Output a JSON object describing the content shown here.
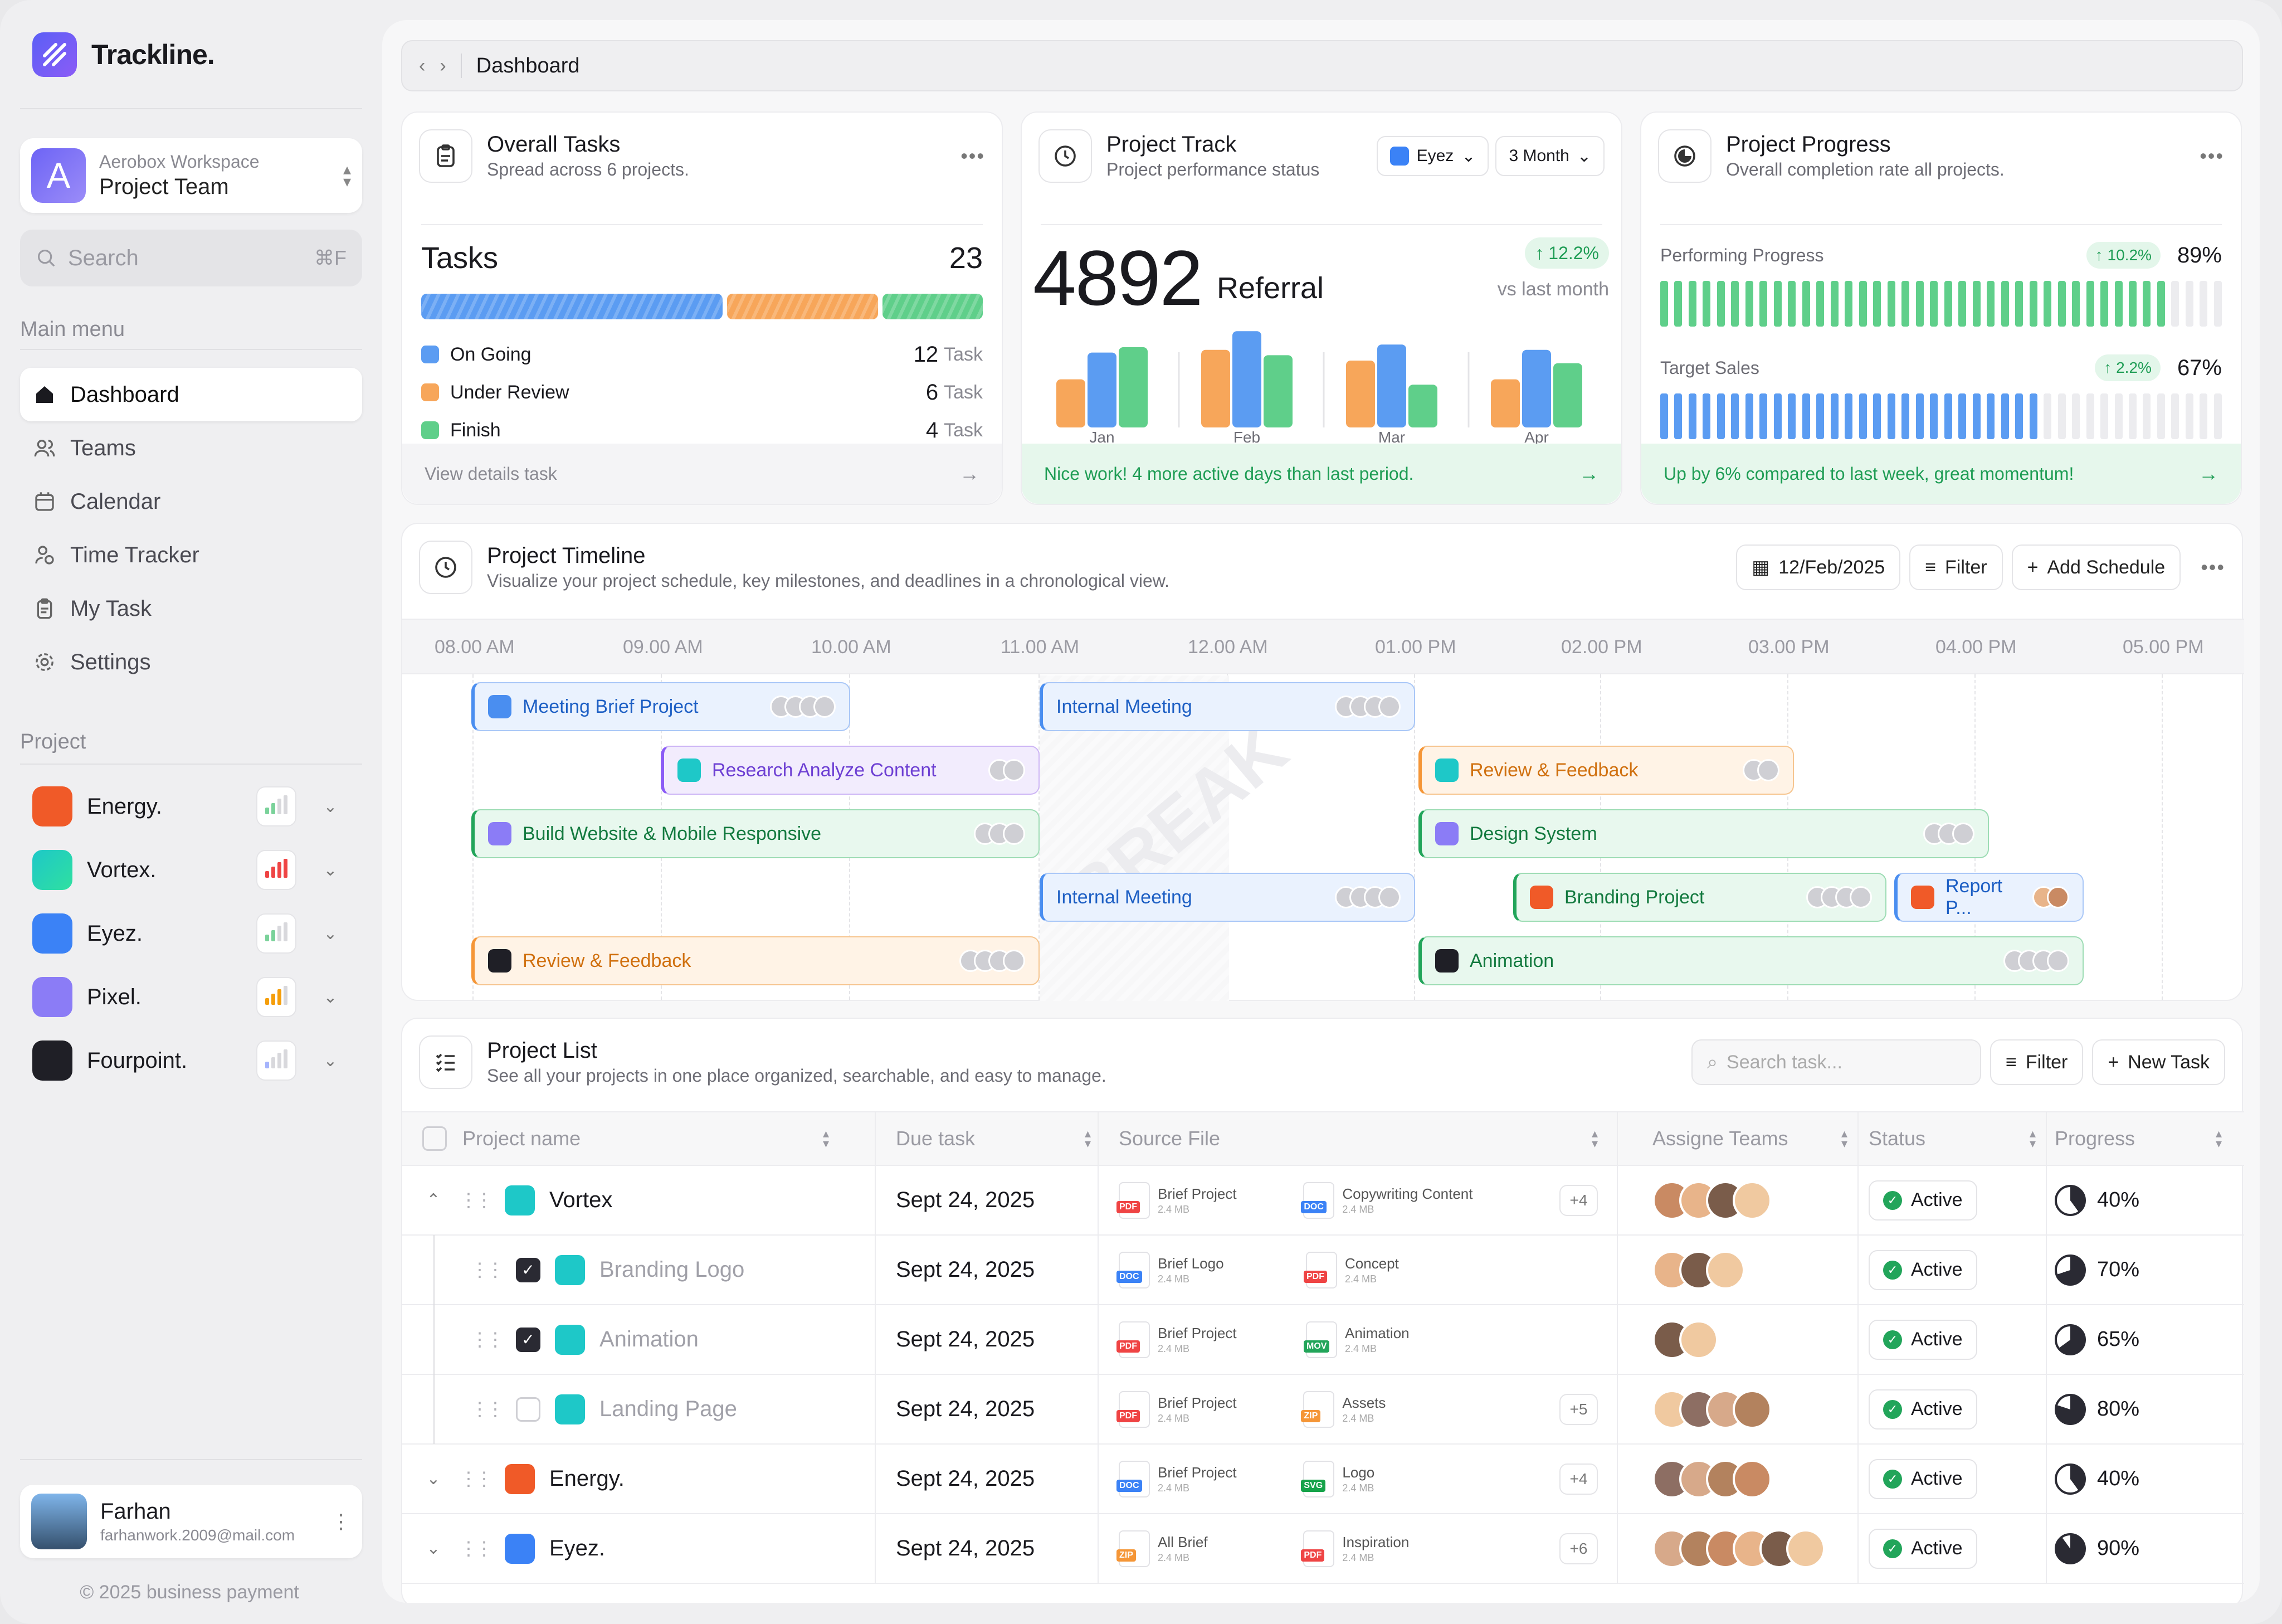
{
  "app": {
    "name": "Trackline.",
    "copyright": "© 2025 business payment"
  },
  "workspace": {
    "avatar": "A",
    "org": "Aerobox Workspace",
    "team": "Project Team"
  },
  "search": {
    "placeholder": "Search",
    "shortcut": "⌘F"
  },
  "sidebar": {
    "main_menu_label": "Main menu",
    "project_label": "Project",
    "menu": [
      {
        "label": "Dashboard",
        "icon": "home-icon",
        "active": true
      },
      {
        "label": "Teams",
        "icon": "users-icon"
      },
      {
        "label": "Calendar",
        "icon": "calendar-icon"
      },
      {
        "label": "Time Tracker",
        "icon": "person-clock-icon"
      },
      {
        "label": "My Task",
        "icon": "clipboard-icon"
      },
      {
        "label": "Settings",
        "icon": "gear-icon"
      }
    ],
    "projects": [
      {
        "name": "Energy.",
        "color": "#f05a28",
        "bar_color": "#7ad29a"
      },
      {
        "name": "Vortex.",
        "color": "#1ec8c8",
        "bar_color": "#ef4444"
      },
      {
        "name": "Eyez.",
        "color": "#3b82f6",
        "bar_color": "#7ad29a"
      },
      {
        "name": "Pixel.",
        "color": "#8b7cf6",
        "bar_color": "#f59e0b"
      },
      {
        "name": "Fourpoint.",
        "color": "#1f1f26",
        "bar_color": "#a5b4fc"
      }
    ]
  },
  "user": {
    "name": "Farhan",
    "email": "farhanwork.2009@mail.com"
  },
  "breadcrumb": {
    "page": "Dashboard"
  },
  "overall_tasks": {
    "title": "Overall Tasks",
    "subtitle": "Spread across 6 projects.",
    "tasks_label": "Tasks",
    "total": "23",
    "unit": "Task",
    "rows": [
      {
        "label": "On Going",
        "count": "12",
        "color": "#5b9cf2"
      },
      {
        "label": "Under Review",
        "count": "6",
        "color": "#f7a65a"
      },
      {
        "label": "Finish",
        "count": "4",
        "color": "#5fcf8a"
      }
    ],
    "footer": "View details task"
  },
  "project_track": {
    "title": "Project Track",
    "subtitle": "Project performance status",
    "project_filter": "Eyez",
    "period": "3 Month",
    "value": "4892",
    "value_label": "Referral",
    "delta": "12.2%",
    "delta_note": "vs last month",
    "chart_data": {
      "type": "bar",
      "categories": [
        "Jan",
        "Feb",
        "Mar",
        "Apr"
      ],
      "series": [
        {
          "values": [
            36,
            58,
            50,
            36
          ],
          "color": "#f7a65a"
        },
        {
          "values": [
            56,
            72,
            62,
            58
          ],
          "color": "#5b9cf2"
        },
        {
          "values": [
            60,
            54,
            32,
            48
          ],
          "color": "#5fcf8a"
        }
      ]
    },
    "footer": "Nice work! 4 more active days than last period."
  },
  "project_progress": {
    "title": "Project Progress",
    "subtitle": "Overall completion rate all projects.",
    "metrics": [
      {
        "label": "Performing Progress",
        "delta": "10.2%",
        "value": "89%",
        "fraction": 0.89,
        "color": "#5fcf8a"
      },
      {
        "label": "Target Sales",
        "delta": "2.2%",
        "value": "67%",
        "fraction": 0.67,
        "color": "#5b9cf2"
      }
    ],
    "footer": "Up by 6% compared to last week, great momentum!"
  },
  "timeline": {
    "title": "Project Timeline",
    "subtitle": "Visualize your project schedule, key milestones, and deadlines in a chronological view.",
    "date": "12/Feb/2025",
    "filter": "Filter",
    "add": "Add Schedule",
    "watermark": "BREAK",
    "hours": [
      "08.00 AM",
      "09.00 AM",
      "10.00 AM",
      "11.00 AM",
      "12.00 AM",
      "01.00 PM",
      "02.00 PM",
      "03.00 PM",
      "04.00 PM",
      "05.00 PM"
    ],
    "tasks": [
      {
        "label": "Meeting Brief Project",
        "style": "blue",
        "icon": "#4a8ef0"
      },
      {
        "label": "Internal Meeting",
        "style": "blue",
        "icon": ""
      },
      {
        "label": "Research Analyze Content",
        "style": "purple",
        "icon": "#1ec8c8"
      },
      {
        "label": "Review & Feedback",
        "style": "orange",
        "icon": "#1ec8c8"
      },
      {
        "label": "Build Website & Mobile Responsive",
        "style": "green",
        "icon": "#8b7cf6"
      },
      {
        "label": "Design System",
        "style": "green",
        "icon": "#8b7cf6"
      },
      {
        "label": "Internal Meeting",
        "style": "blue",
        "icon": ""
      },
      {
        "label": "Branding Project",
        "style": "green",
        "icon": "#f05a28"
      },
      {
        "label": "Report P...",
        "style": "blue",
        "icon": "#f05a28"
      },
      {
        "label": "Review & Feedback",
        "style": "orange",
        "icon": "#1f1f26"
      },
      {
        "label": "Animation",
        "style": "green",
        "icon": "#1f1f26"
      }
    ]
  },
  "project_list": {
    "title": "Project List",
    "subtitle": "See all your projects in one place organized, searchable, and easy to manage.",
    "search_placeholder": "Search task...",
    "filter": "Filter",
    "new": "New Task",
    "columns": [
      "Project name",
      "Due task",
      "Source File",
      "Assigne Teams",
      "Status",
      "Progress"
    ],
    "rows": [
      {
        "name": "Vortex",
        "due": "Sept 24, 2025",
        "f1": "Brief Project",
        "f1t": "PDF",
        "f2": "Copywriting Content",
        "f2t": "DOC",
        "size": "2.4 MB",
        "more": "+4",
        "status": "Active",
        "progress": "40%",
        "icon": "#1ec8c8",
        "level": 0,
        "faded": false
      },
      {
        "name": "Branding Logo",
        "due": "Sept 24, 2025",
        "f1": "Brief Logo",
        "f1t": "DOC",
        "f2": "Concept",
        "f2t": "PDF",
        "size": "2.4 MB",
        "more": "",
        "status": "Active",
        "progress": "70%",
        "icon": "#1ec8c8",
        "level": 1,
        "faded": true
      },
      {
        "name": "Animation",
        "due": "Sept 24, 2025",
        "f1": "Brief Project",
        "f1t": "PDF",
        "f2": "Animation",
        "f2t": "MOV",
        "size": "2.4 MB",
        "more": "",
        "status": "Active",
        "progress": "65%",
        "icon": "#1ec8c8",
        "level": 1,
        "faded": true
      },
      {
        "name": "Landing Page",
        "due": "Sept 24, 2025",
        "f1": "Brief Project",
        "f1t": "PDF",
        "f2": "Assets",
        "f2t": "ZIP",
        "size": "2.4 MB",
        "more": "+5",
        "status": "Active",
        "progress": "80%",
        "icon": "#1ec8c8",
        "level": 1,
        "faded": true
      },
      {
        "name": "Energy.",
        "due": "Sept 24, 2025",
        "f1": "Brief Project",
        "f1t": "DOC",
        "f2": "Logo",
        "f2t": "SVG",
        "size": "2.4 MB",
        "more": "+4",
        "status": "Active",
        "progress": "40%",
        "icon": "#f05a28",
        "level": 0,
        "faded": false
      },
      {
        "name": "Eyez.",
        "due": "Sept 24, 2025",
        "f1": "All Brief",
        "f1t": "ZIP",
        "f2": "Inspiration",
        "f2t": "PDF",
        "size": "2.4 MB",
        "more": "+6",
        "status": "Active",
        "progress": "90%",
        "icon": "#3b82f6",
        "level": 0,
        "faded": false
      }
    ]
  }
}
